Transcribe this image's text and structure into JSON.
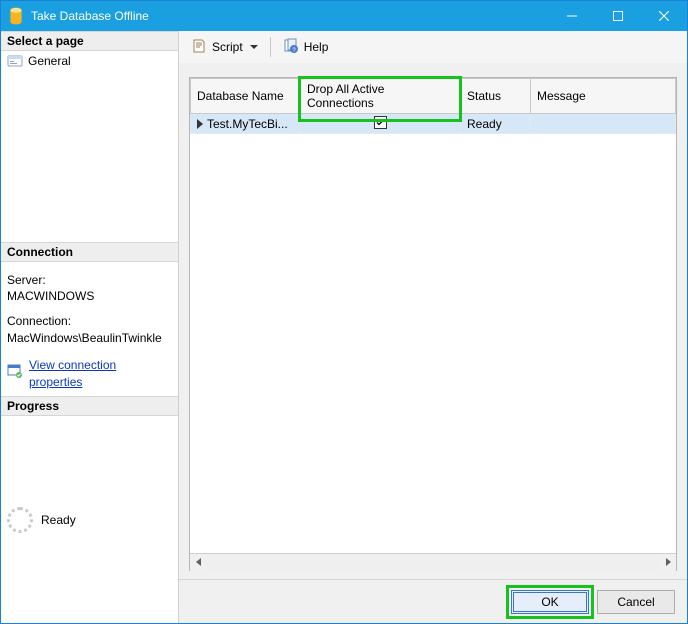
{
  "title": "Take Database Offline",
  "sidebar": {
    "select_page_header": "Select a page",
    "pages": [
      {
        "label": "General"
      }
    ],
    "connection_header": "Connection",
    "server_label": "Server:",
    "server_value": "MACWINDOWS",
    "connection_label": "Connection:",
    "connection_value": "MacWindows\\BeaulinTwinkle",
    "view_conn_props": "View connection properties",
    "progress_header": "Progress",
    "progress_status": "Ready"
  },
  "toolbar": {
    "script_label": "Script",
    "help_label": "Help"
  },
  "grid": {
    "columns": {
      "db_name": "Database Name",
      "drop_conn": "Drop All Active Connections",
      "status": "Status",
      "message": "Message"
    },
    "rows": [
      {
        "db_name": "Test.MyTecBi...",
        "drop_conn_checked": true,
        "status": "Ready",
        "message": ""
      }
    ]
  },
  "buttons": {
    "ok": "OK",
    "cancel": "Cancel"
  }
}
